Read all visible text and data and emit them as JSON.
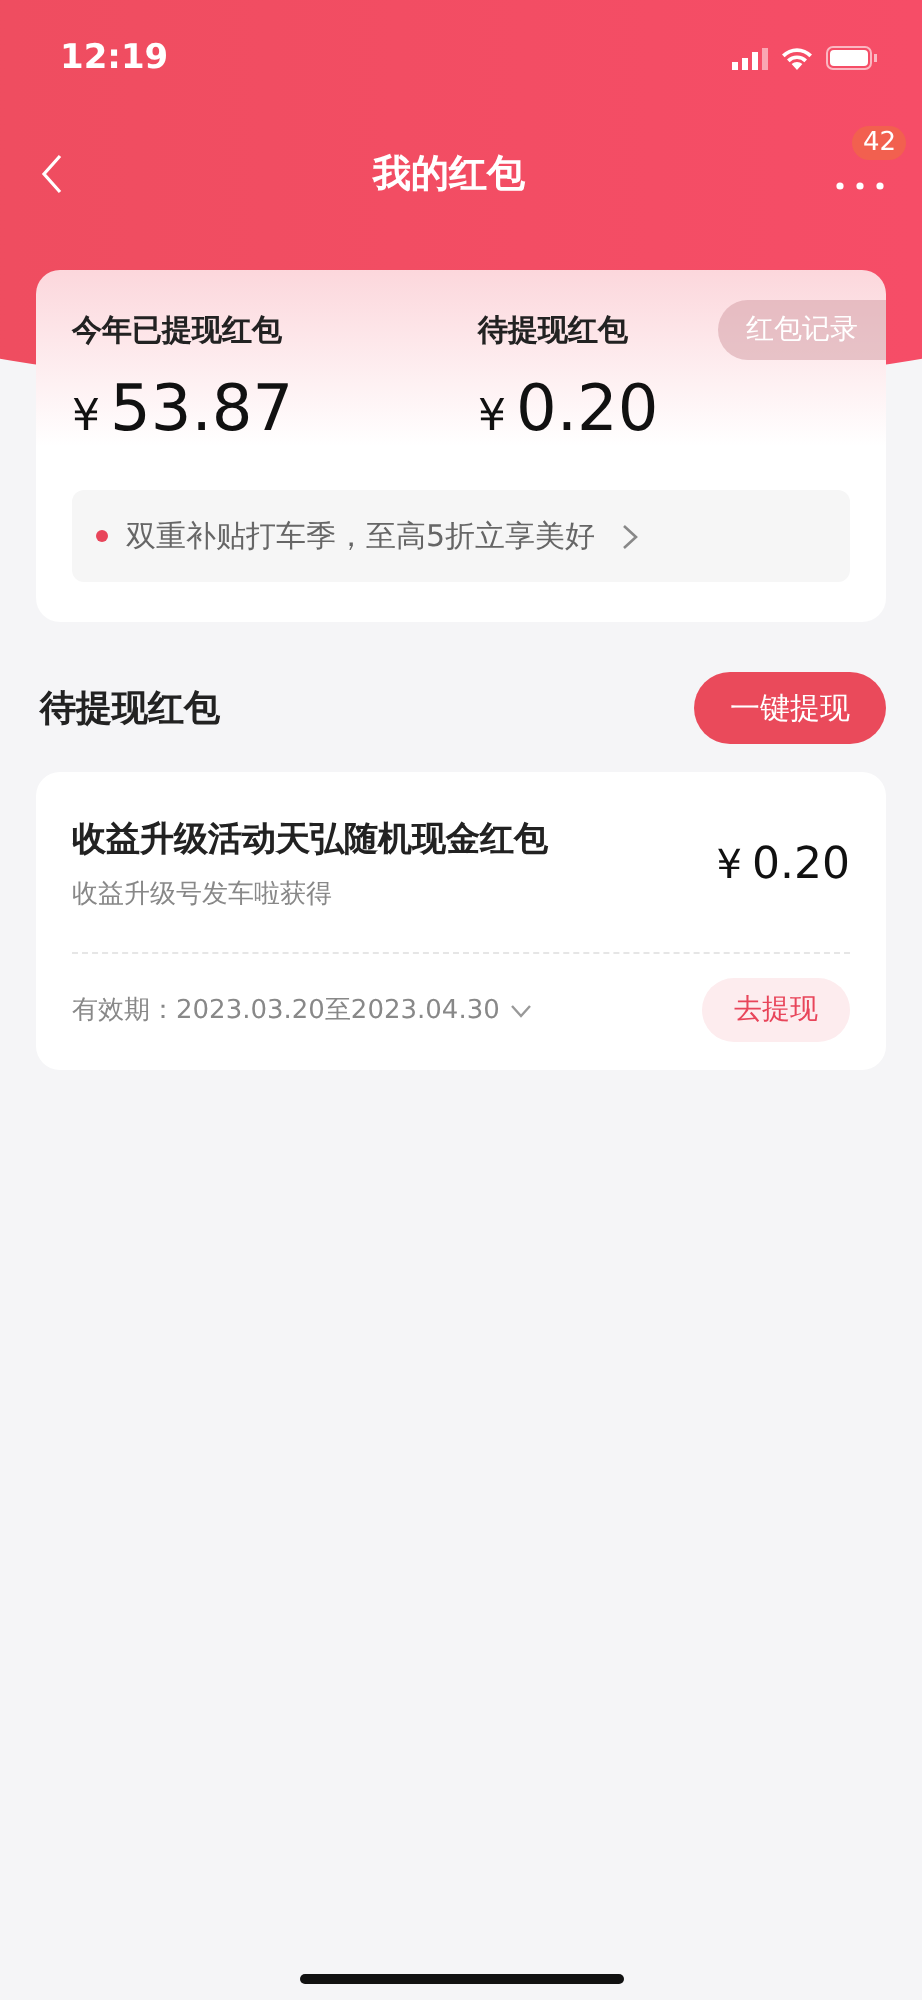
{
  "status_bar": {
    "time": "12:19"
  },
  "nav": {
    "title": "我的红包",
    "badge": "42"
  },
  "summary": {
    "record_button": "红包记录",
    "stats": [
      {
        "label": "今年已提现红包",
        "currency": "¥",
        "amount": "53.87"
      },
      {
        "label": "待提现红包",
        "currency": "¥",
        "amount": "0.20"
      }
    ],
    "promo": {
      "text": "双重补贴打车季，至高5折立享美好",
      "color": "#e8455a"
    }
  },
  "section": {
    "title": "待提现红包",
    "button": "一键提现"
  },
  "packets": [
    {
      "title": "收益升级活动天弘随机现金红包",
      "source": "收益升级号发车啦获得",
      "currency": "¥",
      "amount": "0.20",
      "validity": "有效期：2023.03.20至2023.04.30",
      "button": "去提现"
    }
  ]
}
